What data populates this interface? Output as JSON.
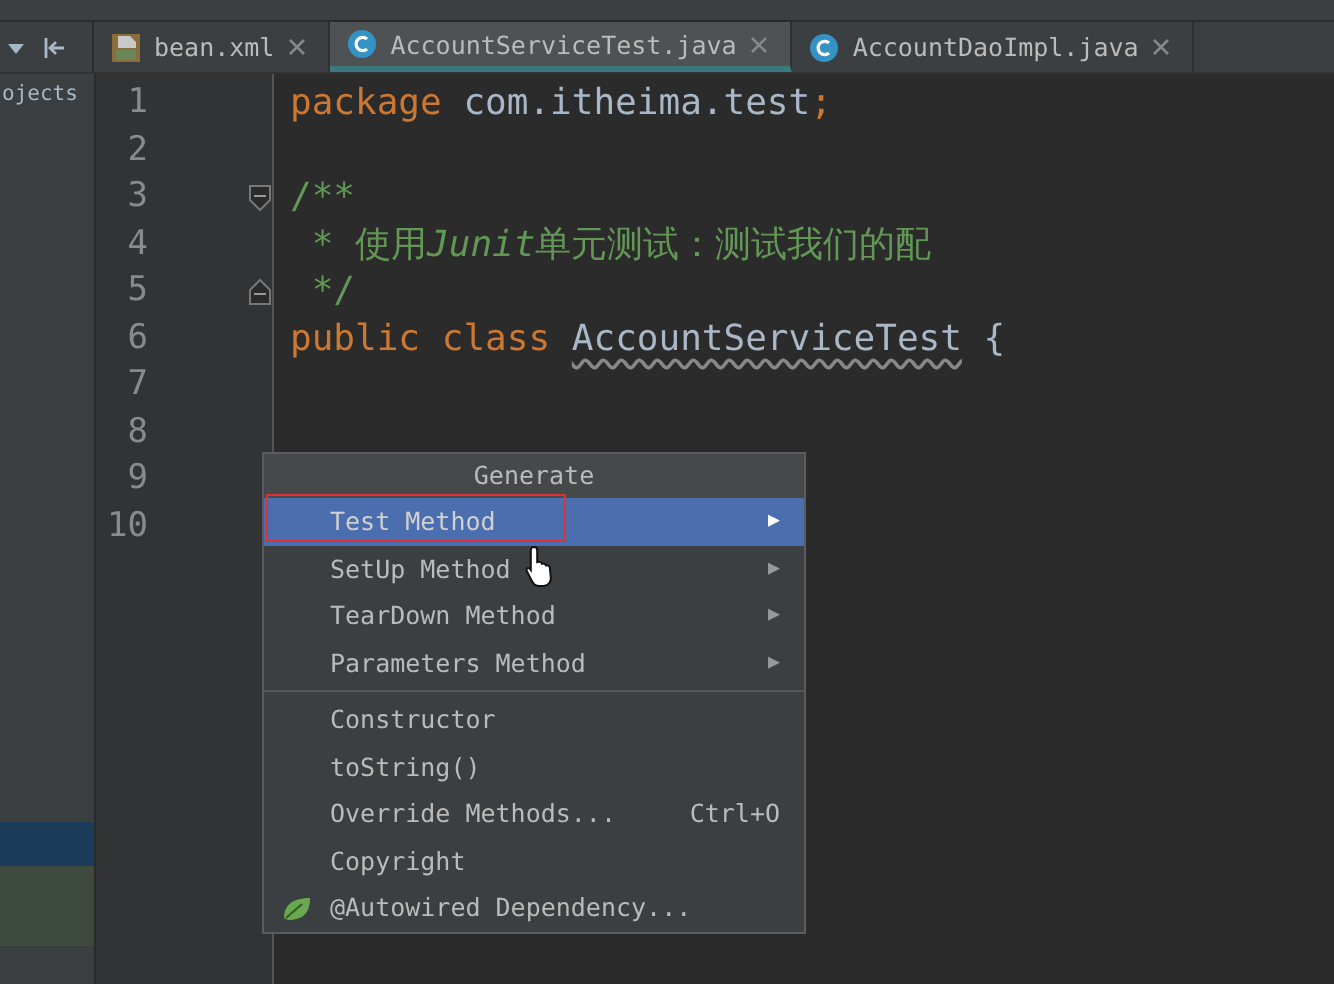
{
  "toolbar": {
    "icons": [
      {
        "kind": "caret"
      },
      {
        "kind": "collapse"
      }
    ]
  },
  "tabs": [
    {
      "label": "bean.xml",
      "kind": "xml",
      "selected": false
    },
    {
      "label": "AccountServiceTest.java",
      "kind": "class",
      "selected": true
    },
    {
      "label": "AccountDaoImpl.java",
      "kind": "class",
      "selected": false
    }
  ],
  "sidebar": {
    "label": "ojects",
    "rows": [
      {
        "selected": true
      },
      {
        "selected": false
      }
    ]
  },
  "editor": {
    "lines": [
      {
        "number": "1",
        "tokens": [
          {
            "kind": "keyword",
            "text": "package"
          },
          {
            "kind": "plain",
            "text": " com.itheima.test"
          },
          {
            "kind": "keyword",
            "text": ";"
          }
        ]
      },
      {
        "number": "2"
      },
      {
        "number": "3",
        "kind": "fold-start",
        "tokens": [
          {
            "kind": "comment",
            "text": "/**"
          }
        ]
      },
      {
        "number": "4",
        "tokens": [
          {
            "kind": "comment",
            "text": " * 使用"
          },
          {
            "kind": "comment-italic",
            "text": "Junit"
          },
          {
            "kind": "comment",
            "text": "单元测试：测试我们的配"
          }
        ]
      },
      {
        "number": "5",
        "kind": "fold-end",
        "tokens": [
          {
            "kind": "comment",
            "text": " */"
          }
        ]
      },
      {
        "number": "6",
        "tokens": [
          {
            "kind": "keyword",
            "text": "public class "
          },
          {
            "kind": "warning",
            "text": "AccountServiceTest"
          },
          {
            "kind": "plain",
            "text": " {"
          }
        ]
      },
      {
        "number": "7"
      },
      {
        "number": "8"
      },
      {
        "number": "9"
      },
      {
        "number": "10"
      }
    ]
  },
  "popup": {
    "title": "Generate",
    "items": [
      {
        "kind": "submenu",
        "label": "Test Method",
        "arrow": "▶",
        "selected": true,
        "outlined": true
      },
      {
        "kind": "submenu",
        "label": "SetUp Method",
        "arrow": "▶",
        "selected": false,
        "outlined": false
      },
      {
        "kind": "submenu",
        "label": "TearDown Method",
        "arrow": "▶",
        "selected": false,
        "outlined": false
      },
      {
        "kind": "submenu",
        "label": "Parameters Method",
        "arrow": "▶",
        "selected": false,
        "outlined": false
      },
      {
        "kind": "separator"
      },
      {
        "kind": "action",
        "label": "Constructor",
        "selected": false,
        "outlined": false
      },
      {
        "kind": "action",
        "label": "toString()",
        "selected": false,
        "outlined": false
      },
      {
        "kind": "action",
        "label": "Override Methods...",
        "shortcut": "Ctrl+O",
        "selected": false,
        "outlined": false
      },
      {
        "kind": "action",
        "label": "Copyright",
        "selected": false,
        "outlined": false
      },
      {
        "kind": "icon-action",
        "label": "@Autowired Dependency...",
        "selected": false,
        "outlined": false
      }
    ]
  }
}
